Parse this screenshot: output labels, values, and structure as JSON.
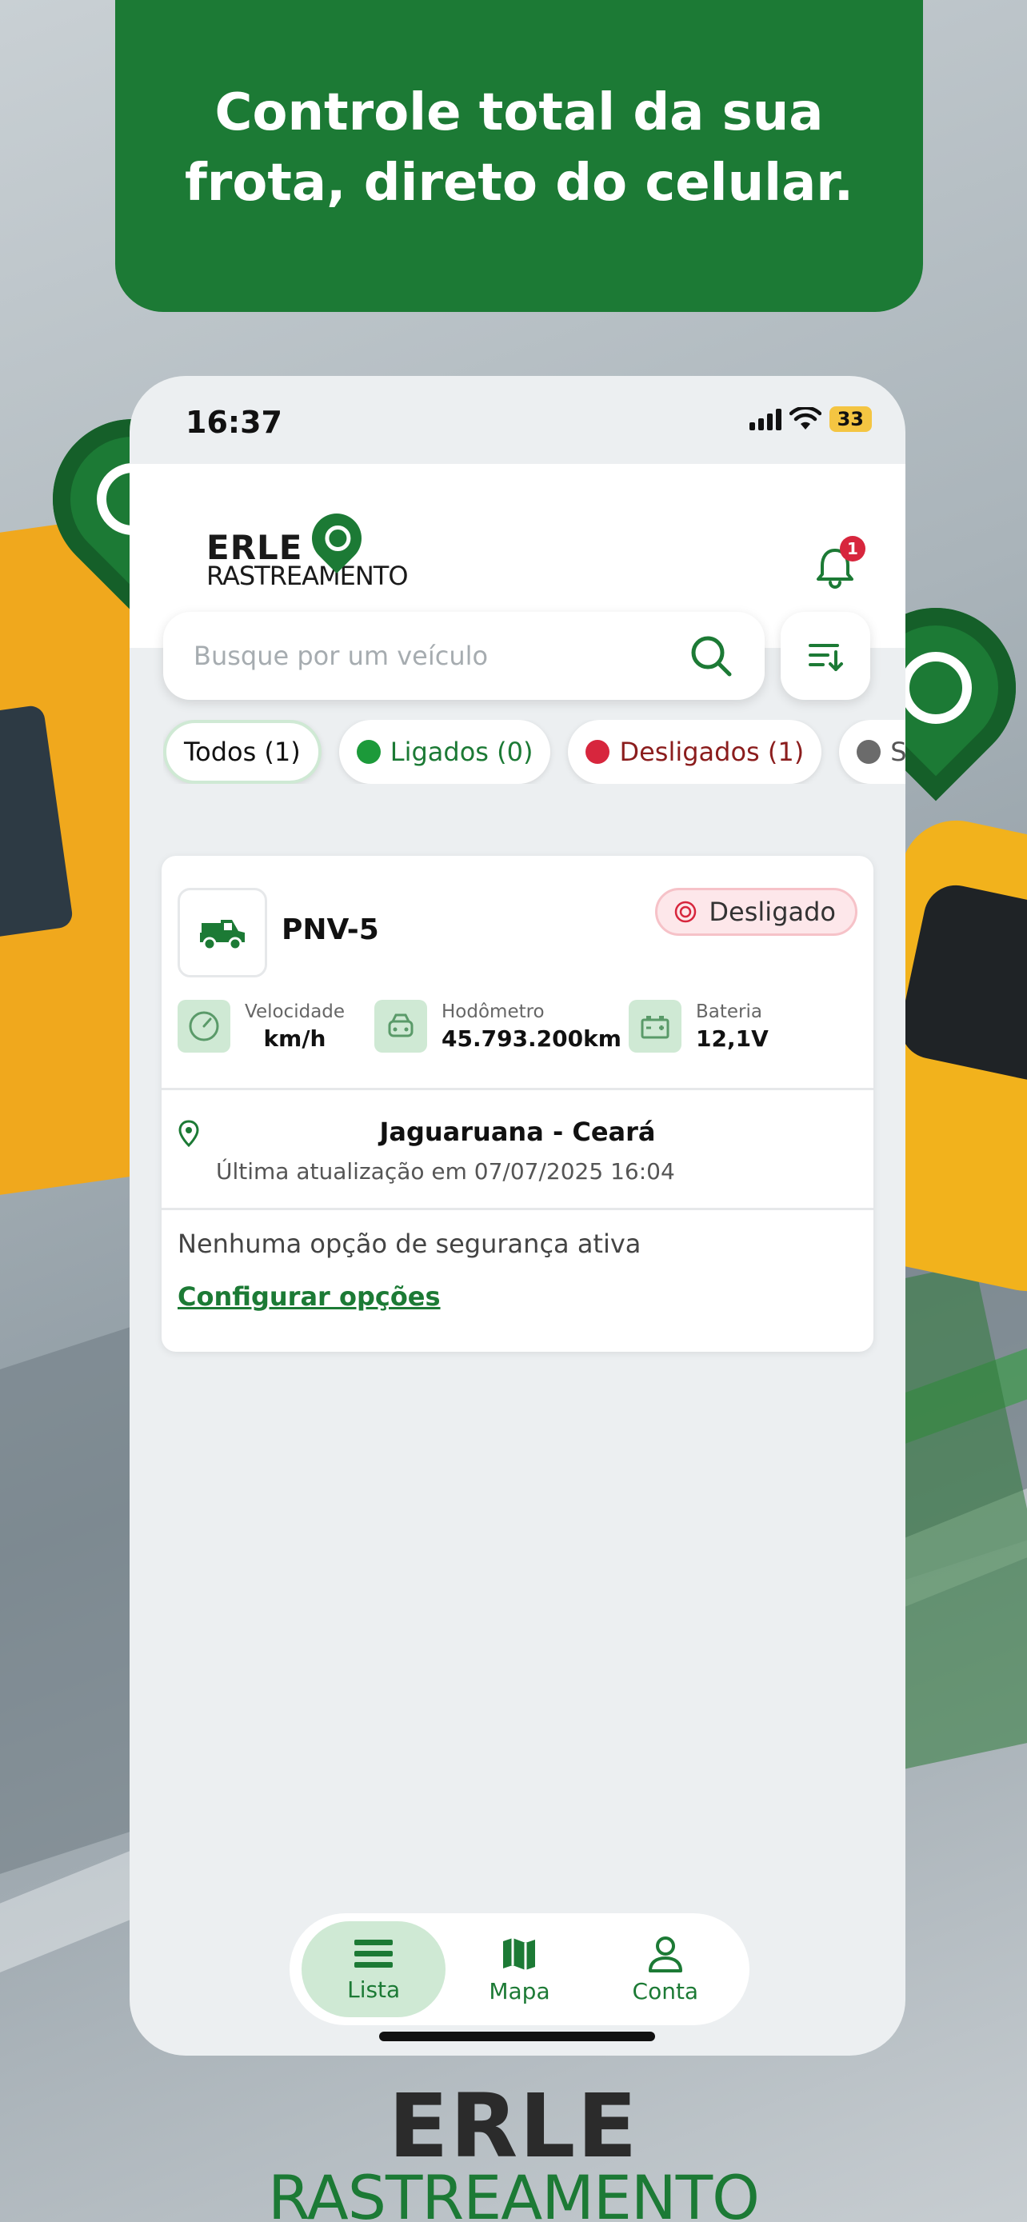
{
  "banner": {
    "title": "Controle total da sua frota, direto do celular."
  },
  "status_bar": {
    "time": "16:37",
    "battery": "33"
  },
  "logo": {
    "line1": "ERLE",
    "line2": "RASTREAMENTO"
  },
  "notifications": {
    "count": "1"
  },
  "search": {
    "placeholder": "Busque por um veículo"
  },
  "filters": [
    {
      "label": "Todos (1)"
    },
    {
      "label": "Ligados (0)",
      "color": "#1c9a3a"
    },
    {
      "label": "Desligados (1)",
      "color": "#d7263d"
    },
    {
      "label": "Sem",
      "color": "#6b6b6b"
    }
  ],
  "vehicle": {
    "plate": "PNV-5",
    "status": "Desligado",
    "metrics": {
      "speed": {
        "label": "Velocidade",
        "value": "km/h"
      },
      "odometer": {
        "label": "Hodômetro",
        "value": "45.793.200km"
      },
      "battery": {
        "label": "Bateria",
        "value": "12,1V"
      }
    },
    "location": "Jaguaruana - Ceará",
    "last_update": "Última atualização em 07/07/2025 16:04",
    "security_text": "Nenhuma opção de segurança ativa",
    "config_link": "Configurar opções"
  },
  "tabs": [
    {
      "label": "Lista",
      "icon": "list-icon"
    },
    {
      "label": "Mapa",
      "icon": "map-icon"
    },
    {
      "label": "Conta",
      "icon": "user-icon"
    }
  ],
  "footer": {
    "line1": "ERLE",
    "line2": "RASTREAMENTO"
  },
  "colors": {
    "brand_green": "#1c7a35",
    "light_green": "#cfe9d4",
    "alert_red": "#d7263d"
  }
}
